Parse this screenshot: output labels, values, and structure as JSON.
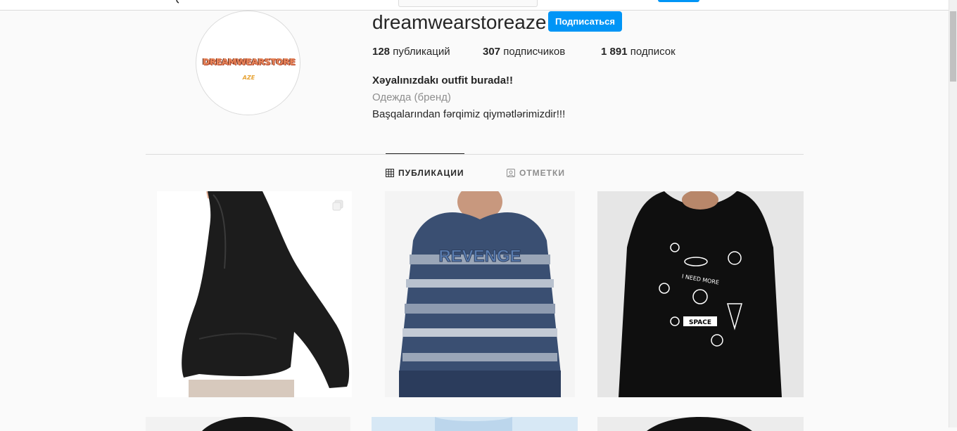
{
  "profile": {
    "username": "dreamwearstoreaze",
    "follow_label": "Подписаться",
    "avatar_logo_text": "DREAMWEARSTORE",
    "avatar_logo_sub": "AZE",
    "stats": {
      "posts_count": "128",
      "posts_label": "публикаций",
      "followers_count": "307",
      "followers_label": "подписчиков",
      "following_count": "1 891",
      "following_label": "подписок"
    },
    "bio": {
      "name": "Xəyalınızdakı outfit burada!!",
      "category": "Одежда (бренд)",
      "text": "Başqalarından fərqimiz qiymətlərimizdir!!!"
    }
  },
  "tabs": [
    {
      "label": "ПУБЛИКАЦИИ",
      "icon": "grid-icon",
      "active": true
    },
    {
      "label": "ОТМЕТКИ",
      "icon": "tagged-user-icon",
      "active": false
    }
  ],
  "posts": [
    {
      "description": "woman in black hoodie",
      "multi": true
    },
    {
      "description": "man in blue camo hoodie",
      "graphic_text": "REVENGE"
    },
    {
      "description": "black hoodie with space print",
      "graphic_text_1": "I NEED MORE",
      "graphic_text_2": "SPACE"
    },
    {
      "description": "black hoodie (partially visible)"
    },
    {
      "description": "light blue shirt (partially visible)"
    },
    {
      "description": "black hoodie (partially visible)"
    }
  ],
  "colors": {
    "accent": "#0095f6",
    "background": "#fafafa",
    "text": "#262626",
    "muted": "#8e8e8e",
    "border": "#dbdbdb"
  }
}
